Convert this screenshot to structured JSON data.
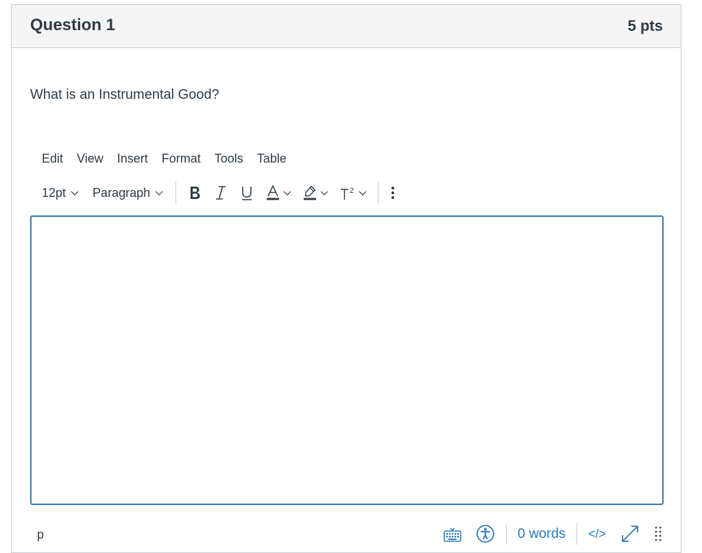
{
  "question": {
    "title": "Question 1",
    "points": "5 pts",
    "text": "What is an Instrumental Good?"
  },
  "editor": {
    "menubar": [
      "Edit",
      "View",
      "Insert",
      "Format",
      "Tools",
      "Table"
    ],
    "toolbar": {
      "font_size": "12pt",
      "block_format": "Paragraph",
      "icons": [
        "bold-icon",
        "italic-icon",
        "underline-icon",
        "text-color-icon",
        "highlight-color-icon",
        "superscript-icon",
        "more-options-icon"
      ]
    },
    "content": "",
    "status": {
      "path": "p",
      "word_count": "0 words",
      "html_toggle": "</>"
    }
  },
  "colors": {
    "accent": "#2b7abc",
    "text": "#2d3b45",
    "border": "#c7cdd1",
    "header_bg": "#f5f5f5"
  }
}
